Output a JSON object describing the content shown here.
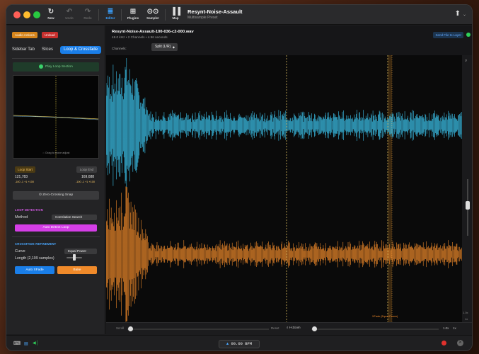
{
  "toolbar": {
    "app_title": "Resynt-Noise-Assault",
    "app_subtitle": "Multisample Preset",
    "buttons": [
      {
        "label": "New"
      },
      {
        "label": "Undo"
      },
      {
        "label": "Redo"
      },
      {
        "label": "Editor"
      },
      {
        "label": "Plugins"
      },
      {
        "label": "Sampler"
      },
      {
        "label": "Map"
      }
    ]
  },
  "sidebar": {
    "audio_actions": "Audio Actions",
    "unload": "Unload",
    "tabs": [
      "Sidebar Tab",
      "Slices",
      "Loop & Crossfade"
    ],
    "play_loop": "Play Loop Section",
    "preview_hint": "⇔ Drag to move adjust",
    "loop_start_label": "Loop Start",
    "loop_end_label": "Loop End",
    "loop_start_value": "121,783",
    "loop_end_value": "169,688",
    "loop_start_nudge": "-100 -1 +1 +100",
    "loop_end_nudge": "-100 -1 +1 +100",
    "zero_crossing": "Zero-Crossing Snap",
    "loop_detection": {
      "header": "LOOP DETECTION",
      "method_label": "Method",
      "method_value": "Correlation Search",
      "auto_detect": "Auto Detect Loop"
    },
    "crossfade": {
      "header": "CROSSFADE REFINEMENT",
      "curve_label": "Curve",
      "curve_value": "Equal Power",
      "length_label": "Length (2,199 samples)",
      "length_fraction": 0.45,
      "auto_xfade": "Auto XFade",
      "bake": "Bake"
    }
  },
  "main": {
    "file_name": "Resynt-Noise-Assault-100-036-c2-000.wav",
    "file_info": "48.0 kHz • 2 Channels • 4.96 seconds",
    "send_button": "Send File to Layer",
    "channels_label": "Channels:",
    "channels_value": "Split (L/R)",
    "xfade_label": "XFade (Equal Power)",
    "scroll_label": "Scroll",
    "reset_label": "Reset",
    "hzoom_label": "H-Zoom",
    "hzoom_value": "1.0x",
    "hzoom_reset": "1x",
    "vzoom_value": "1.0x",
    "vzoom_reset": "1x"
  },
  "statusbar": {
    "bpm": "90.00 BPM"
  },
  "colors": {
    "accent_blue": "#1a7ee8",
    "wave_left": "#3cc6f0",
    "wave_right": "#f08a2a",
    "loop_marker": "#f5d36a",
    "auto_detect": "#d43ee6",
    "bake": "#f08a2a",
    "record": "#e0312d"
  },
  "icons": [
    "new-icon",
    "undo-icon",
    "redo-icon",
    "editor-icon",
    "plugins-icon",
    "sampler-icon",
    "map-icon",
    "share-icon",
    "play-icon",
    "zoom-icon",
    "record-icon",
    "close-icon"
  ]
}
